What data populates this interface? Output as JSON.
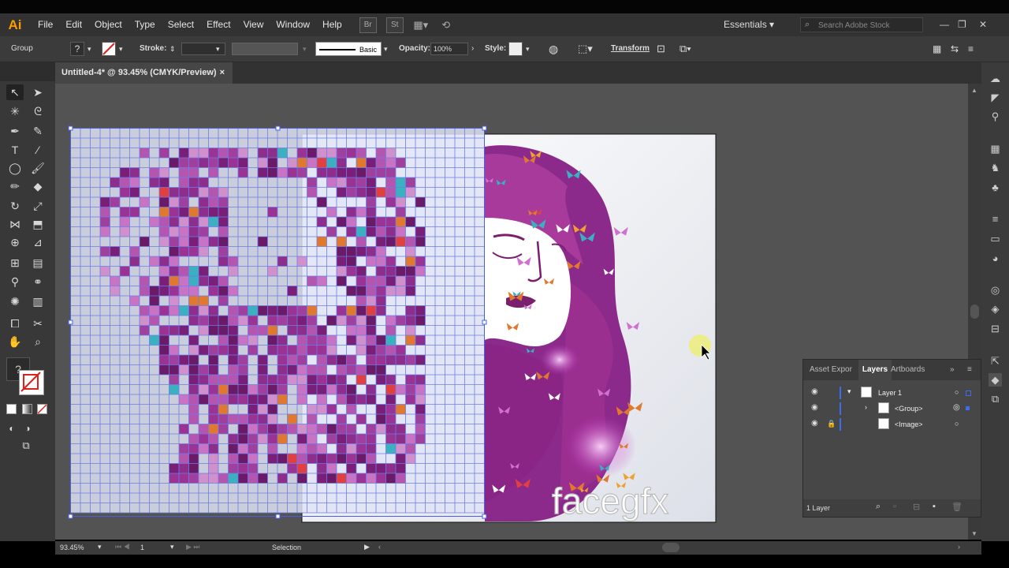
{
  "app": {
    "logo": "Ai"
  },
  "menu": [
    "File",
    "Edit",
    "Object",
    "Type",
    "Select",
    "Effect",
    "View",
    "Window",
    "Help"
  ],
  "menu_buttons": [
    "Br",
    "St"
  ],
  "workspace": "Essentials",
  "search_placeholder": "Search Adobe Stock",
  "control_bar": {
    "selection_type": "Group",
    "stroke_label": "Stroke:",
    "brush": "Basic",
    "opacity_label": "Opacity:",
    "opacity_value": "100%",
    "style_label": "Style:",
    "transform": "Transform"
  },
  "document_tab": {
    "title": "Untitled-4* @ 93.45% (CMYK/Preview)",
    "close": "×"
  },
  "canvas": {
    "watermark": "facegfx"
  },
  "layers_panel": {
    "tabs": [
      "Asset Expor",
      "Layers",
      "Artboards"
    ],
    "rows": [
      {
        "name": "Layer 1"
      },
      {
        "name": "<Group>"
      },
      {
        "name": "<Image>"
      }
    ],
    "footer": "1 Layer"
  },
  "status": {
    "zoom": "93.45%",
    "page": "1",
    "tool": "Selection"
  },
  "colors": {
    "accent": "#ff9a00",
    "selection": "#4a5fe0",
    "layer_blue": "#3a6df0"
  }
}
